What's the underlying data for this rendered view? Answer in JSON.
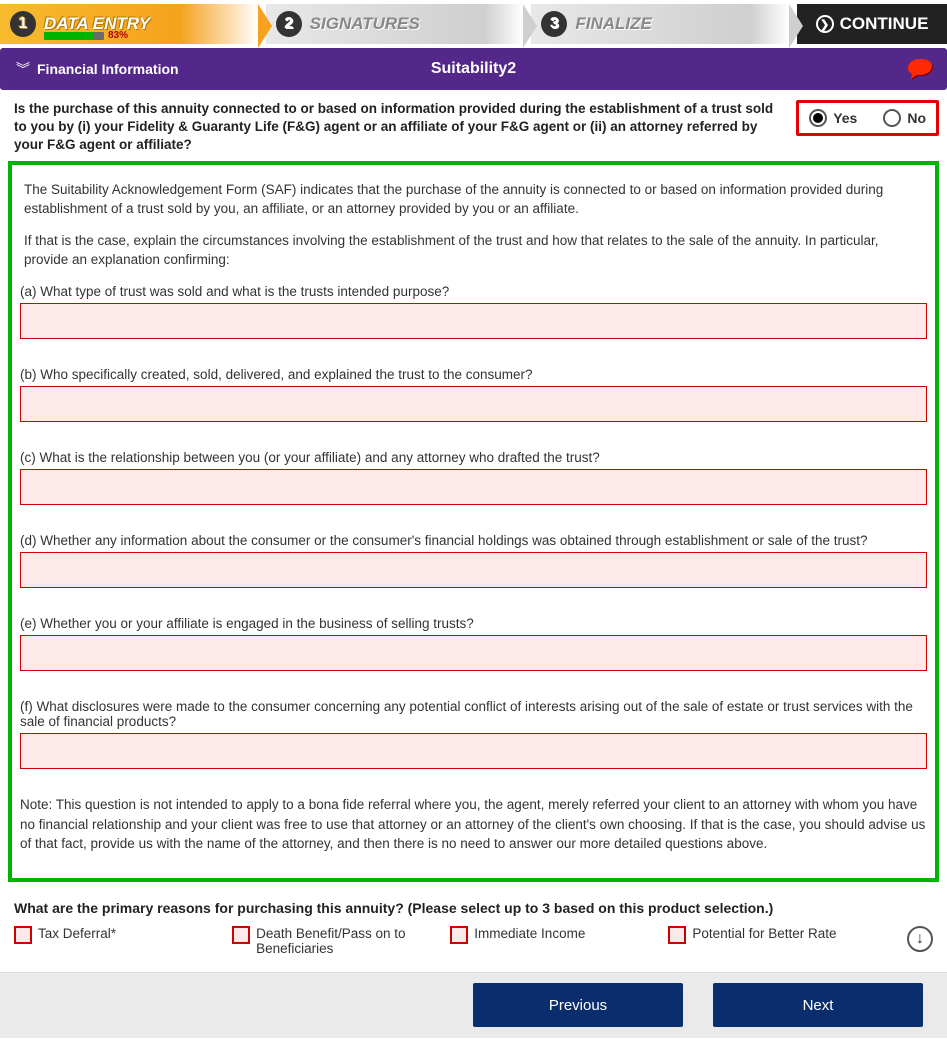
{
  "steps": {
    "s1": {
      "num": "1",
      "label": "DATA ENTRY",
      "progress_pct": "83%",
      "progress_width": "83%"
    },
    "s2": {
      "num": "2",
      "label": "SIGNATURES"
    },
    "s3": {
      "num": "3",
      "label": "FINALIZE"
    }
  },
  "continue_label": "CONTINUE",
  "purple": {
    "section": "Financial Information",
    "title": "Suitability2"
  },
  "question_main": "Is the purchase of this annuity connected to or based on information provided during the establishment of a trust sold to you by (i) your Fidelity & Guaranty Life (F&G) agent or an affiliate of your F&G agent or (ii) an attorney referred by your F&G agent or affiliate?",
  "yes": "Yes",
  "no": "No",
  "saf_p1": "The Suitability Acknowledgement Form (SAF) indicates that the purchase of the annuity is connected to or based on information provided during establishment of a trust sold by you, an affiliate, or an attorney provided by you or an affiliate.",
  "saf_p2": "If that is the case, explain the circumstances involving the establishment of the trust and how that relates to the sale of the annuity. In particular, provide an explanation confirming:",
  "qa": "(a) What type of trust was sold and what is the trusts intended purpose?",
  "qb": "(b) Who specifically created, sold, delivered, and explained the trust to the consumer?",
  "qc": "(c) What is the relationship between you (or your affiliate) and any attorney who drafted the trust?",
  "qd": "(d) Whether any information about the consumer or the consumer's financial holdings was obtained through establishment or sale of the trust?",
  "qe": "(e) Whether you or your affiliate is engaged in the business of selling trusts?",
  "qf": "(f) What disclosures were made to the consumer concerning any potential conflict of interests arising out of the sale of estate or trust services with the sale of financial products?",
  "note": "Note: This question is not intended to apply to a bona fide referral where you, the agent, merely referred your client to an attorney with whom you have no financial relationship and your client was free to use that attorney or an attorney of the client's own choosing. If that is the case, you should advise us of that fact, provide us with the name of the attorney, and then there is no need to answer our more detailed questions above.",
  "reasons_title": "What are the primary reasons for purchasing this annuity? (Please select up to 3 based on this product selection.)",
  "reasons": {
    "r1": "Tax Deferral*",
    "r2": "Death Benefit/Pass on to Beneficiaries",
    "r3": "Immediate Income",
    "r4": "Potential for Better Rate"
  },
  "nav": {
    "prev": "Previous",
    "next": "Next"
  }
}
